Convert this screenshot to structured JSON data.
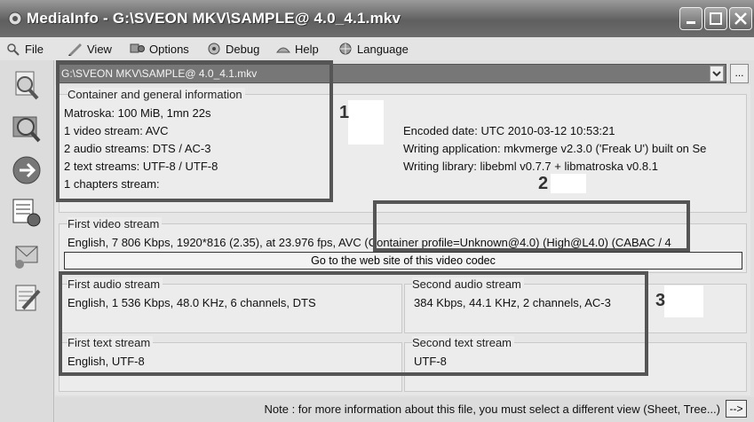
{
  "window": {
    "title": "MediaInfo - G:\\SVEON MKV\\SAMPLE@ 4.0_4.1.mkv"
  },
  "menu": {
    "file": "File",
    "view": "View",
    "options": "Options",
    "debug": "Debug",
    "help": "Help",
    "language": "Language"
  },
  "path": {
    "value": "G:\\SVEON MKV\\SAMPLE@ 4.0_4.1.mkv",
    "browse_label": "..."
  },
  "general": {
    "legend": "Container and general information",
    "lines": [
      "Matroska: 100 MiB, 1mn 22s",
      "1 video stream: AVC",
      "2 audio streams: DTS / AC-3",
      "2 text streams: UTF-8 / UTF-8",
      "1 chapters stream:"
    ],
    "right_lines": [
      "Encoded date: UTC 2010-03-12 10:53:21",
      "Writing application: mkvmerge v2.3.0 ('Freak U') built on Se",
      "Writing library: libebml v0.7.7 + libmatroska v0.8.1"
    ]
  },
  "video": {
    "legend": "First video stream",
    "line": "English, 7 806 Kbps, 1920*816 (2.35), at 23.976 fps, AVC (Container profile=Unknown@4.0) (High@L4.0) (CABAC / 4",
    "codec_button": "Go to the web site of this video codec"
  },
  "audio1": {
    "legend": "First audio stream",
    "line": "English, 1 536 Kbps, 48.0 KHz, 6 channels, DTS"
  },
  "audio2": {
    "legend": "Second audio stream",
    "line": "384 Kbps, 44.1 KHz, 2 channels, AC-3"
  },
  "text1": {
    "legend": "First text stream",
    "line": "English, UTF-8"
  },
  "text2": {
    "legend": "Second text stream",
    "line": "UTF-8"
  },
  "callouts": {
    "one": "1",
    "two": "2",
    "three": "3"
  },
  "status": {
    "note": "Note : for more information about this file, you must select a different view (Sheet, Tree...)",
    "arrow_label": "-->"
  }
}
